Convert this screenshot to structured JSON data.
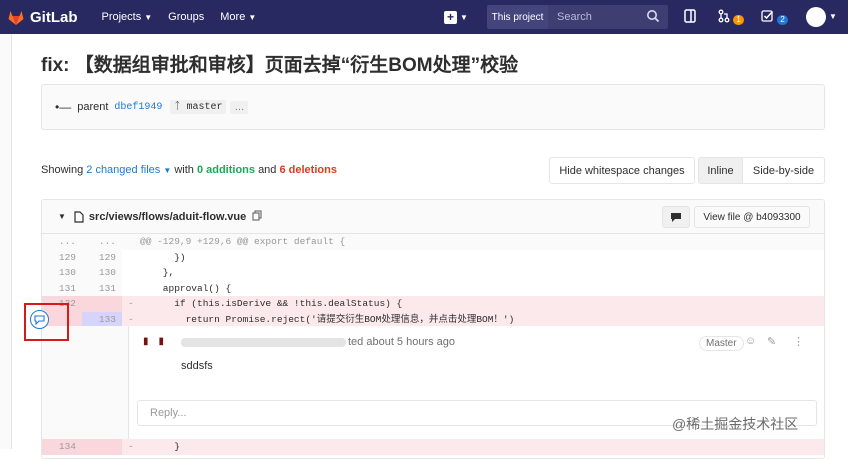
{
  "header": {
    "brand": "GitLab",
    "nav": [
      {
        "label": "Projects",
        "icon": "chevron-down-icon"
      },
      {
        "label": "Groups"
      },
      {
        "label": "More",
        "icon": "chevron-down-icon"
      }
    ],
    "scope_label": "This project",
    "search_placeholder": "Search",
    "issues_count": "1",
    "todos_count": "2",
    "colors": {
      "bar": "#292961",
      "issues_badge": "#fc9403",
      "todos_badge": "#1f78d1"
    }
  },
  "commit": {
    "title": "fix: 【数据组审批和审核】页面去掉“衍生BOM处理”校验",
    "parent_label": "parent",
    "parent_sha": "dbef1949",
    "branch": "master",
    "more": "…"
  },
  "diff_stats": {
    "showing": "Showing",
    "files_link": "2 changed files",
    "with": "with",
    "additions": "0 additions",
    "and": "and",
    "deletions": "6 deletions"
  },
  "view_buttons": {
    "whitespace": "Hide whitespace changes",
    "inline": "Inline",
    "side_by_side": "Side-by-side"
  },
  "file": {
    "path": "src/views/flows/aduit-flow.vue",
    "view_file": "View file @ b4093300",
    "lines": [
      {
        "type": "meta",
        "old": "...",
        "new": "...",
        "sign": "",
        "code": "@@ -129,9 +129,6 @@ export default {"
      },
      {
        "type": "ctx",
        "old": "129",
        "new": "129",
        "sign": "",
        "code": "      })"
      },
      {
        "type": "ctx",
        "old": "130",
        "new": "130",
        "sign": "",
        "code": "    },"
      },
      {
        "type": "ctx",
        "old": "131",
        "new": "131",
        "sign": "",
        "code": "    approval() {"
      },
      {
        "type": "del",
        "old": "132",
        "new": "",
        "sign": "-",
        "code": "      if (this.isDerive && !this.dealStatus) {"
      },
      {
        "type": "sel",
        "old": "",
        "new": "133",
        "sign": "-",
        "code": "        return Promise.reject('请提交衍生BOM处理信息，并点击处理BOM！')"
      }
    ],
    "note": {
      "author_tail": "ted about 5 hours ago",
      "role": "Master",
      "body": "sddsfs",
      "reply_placeholder": "Reply..."
    },
    "bottom_line": {
      "old": "134",
      "new": "",
      "sign": "-",
      "code": "      }"
    }
  },
  "watermark": "@稀土掘金技术社区"
}
